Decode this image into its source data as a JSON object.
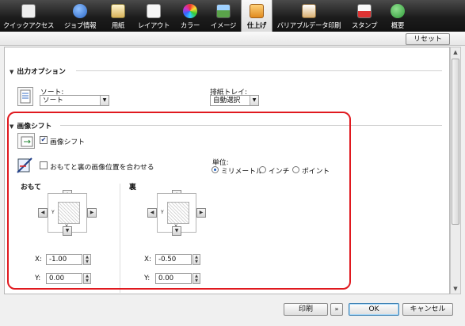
{
  "tabs": [
    {
      "label": "クイックアクセス",
      "icon": "quick-access-icon",
      "color": "#c0c0c0"
    },
    {
      "label": "ジョブ情報",
      "icon": "info-icon",
      "color": "#3d7ed9"
    },
    {
      "label": "用紙",
      "icon": "paper-stack-icon",
      "color": "#e8d28a"
    },
    {
      "label": "レイアウト",
      "icon": "layout-icon",
      "color": "#dedede"
    },
    {
      "label": "カラー",
      "icon": "color-wheel-icon",
      "color": "#e04a4a"
    },
    {
      "label": "イメージ",
      "icon": "image-icon",
      "color": "#6aa84f"
    },
    {
      "label": "仕上げ",
      "icon": "finishing-icon",
      "color": "#e8a23c"
    },
    {
      "label": "バリアブルデータ印刷",
      "icon": "variable-data-icon",
      "color": "#d6a86a"
    },
    {
      "label": "スタンプ",
      "icon": "stamp-icon",
      "color": "#d04545"
    },
    {
      "label": "概要",
      "icon": "summary-check-icon",
      "color": "#3aa043"
    }
  ],
  "active_tab": "仕上げ",
  "reset_label": "リセット",
  "output": {
    "title": "出力オプション",
    "sort_label": "ソート:",
    "sort_value": "ソート",
    "tray_label": "排紙トレイ:",
    "tray_value": "自動選択"
  },
  "shift": {
    "title": "画像シフト",
    "image_shift_label": "画像シフト",
    "image_shift_checked": true,
    "align_label": "おもてと裏の画像位置を合わせる",
    "align_checked": false,
    "unit_label": "単位:",
    "units": [
      "ミリメートル",
      "インチ",
      "ポイント"
    ],
    "unit_selected": 0,
    "front": {
      "title": "おもて",
      "x_label": "X:",
      "x_value": "-1.00",
      "y_label": "Y:",
      "y_value": "0.00"
    },
    "back": {
      "title": "裏",
      "x_label": "X:",
      "x_value": "-0.50",
      "y_label": "Y:",
      "y_value": "0.00"
    },
    "axis_y": "Y",
    "axis_x": "X"
  },
  "footer": {
    "print_label": "印刷",
    "ok_label": "OK",
    "cancel_label": "キャンセル"
  },
  "highlight_color": "#e0191f"
}
